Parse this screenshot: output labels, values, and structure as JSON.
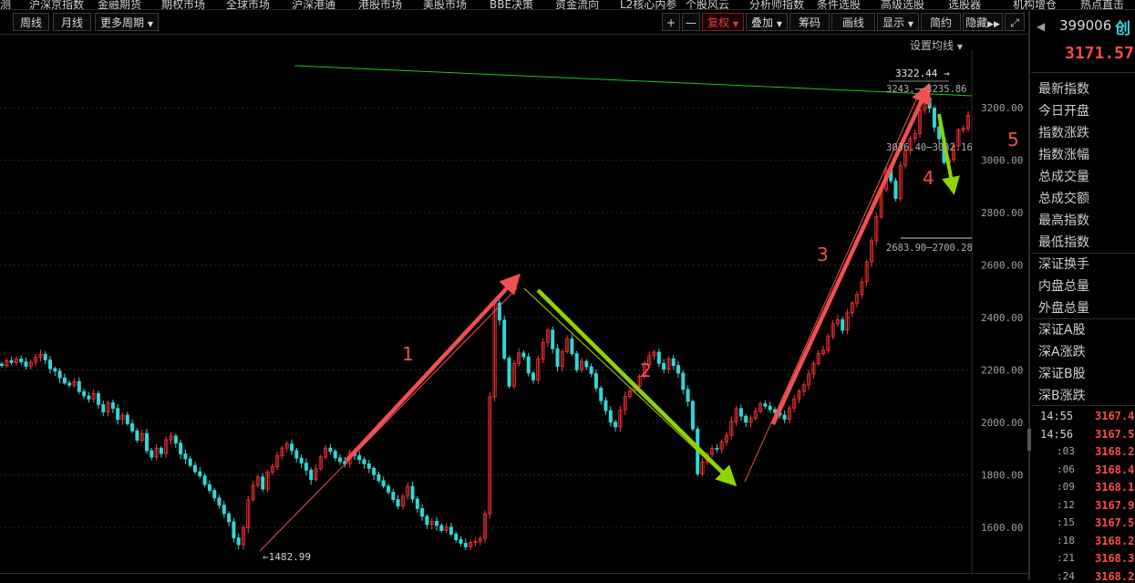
{
  "top_menu": [
    "测",
    "沪深京指数",
    "金融期货",
    "期权市场",
    "全球市场",
    "沪深港通",
    "港股市场",
    "美股市场",
    "BBE决策",
    "资金流向",
    "L2核心内参",
    "个股风云",
    "分析师指数",
    "条件选股",
    "高级选股",
    "选股器",
    "机构增仓",
    "热点直击"
  ],
  "toolbar": {
    "periods": [
      "周线",
      "月线",
      "更多周期"
    ],
    "plus": "+",
    "minus": "—",
    "restore_right": "复权",
    "overlay": "叠加",
    "chips": "筹码",
    "draw": "画线",
    "display": "显示",
    "simple": "简约",
    "hide": "隐藏"
  },
  "set_ma_label": "设置均线",
  "chart_data": {
    "type": "candlestick",
    "y_axis_ticks": [
      3200,
      3000,
      2800,
      2600,
      2400,
      2200,
      2000,
      1800,
      1600
    ],
    "y_tick_labels": [
      "3200.00",
      "3000.00",
      "2800.00",
      "2600.00",
      "2400.00",
      "2200.00",
      "2000.00",
      "1800.00",
      "1600.00"
    ],
    "ylim": [
      1500,
      3330
    ],
    "annotations": {
      "low_marker": "←1482.99",
      "high_marker": "3322.44 →",
      "box_top": "3243.──3235.86",
      "box_mid": "3036.40─3032.16",
      "box_low": "2683.90─2700.28"
    },
    "wave_labels": [
      "1",
      "2",
      "3",
      "4",
      "5"
    ],
    "closes": [
      2217,
      2235,
      2228,
      2242,
      2231,
      2214,
      2229,
      2248,
      2260,
      2238,
      2205,
      2196,
      2170,
      2150,
      2142,
      2156,
      2118,
      2101,
      2089,
      2110,
      2068,
      2040,
      2075,
      2053,
      2011,
      2028,
      1995,
      1968,
      1932,
      1958,
      1892,
      1868,
      1902,
      1881,
      1934,
      1948,
      1921,
      1880,
      1861,
      1836,
      1812,
      1796,
      1763,
      1741,
      1712,
      1685,
      1652,
      1621,
      1560,
      1534,
      1598,
      1705,
      1760,
      1792,
      1746,
      1811,
      1831,
      1873,
      1902,
      1918,
      1893,
      1864,
      1845,
      1818,
      1782,
      1824,
      1868,
      1902,
      1890,
      1865,
      1851,
      1842,
      1886,
      1874,
      1858,
      1842,
      1825,
      1801,
      1778,
      1757,
      1734,
      1706,
      1681,
      1719,
      1756,
      1708,
      1672,
      1642,
      1611,
      1623,
      1607,
      1588,
      1601,
      1574,
      1553,
      1539,
      1526,
      1542,
      1547,
      1558,
      1652,
      2098,
      2455,
      2390,
      2245,
      2138,
      2224,
      2265,
      2250,
      2188,
      2162,
      2242,
      2305,
      2352,
      2281,
      2214,
      2270,
      2318,
      2262,
      2201,
      2233,
      2212,
      2186,
      2131,
      2083,
      2045,
      2001,
      1983,
      2048,
      2099,
      2120,
      2138,
      2176,
      2221,
      2254,
      2268,
      2225,
      2203,
      2243,
      2217,
      2188,
      2126,
      2080,
      1975,
      1804,
      1849,
      1878,
      1901,
      1898,
      1925,
      1951,
      2004,
      2053,
      2024,
      2001,
      2015,
      2042,
      2071,
      2062,
      2049,
      2038,
      2028,
      2012,
      2055,
      2090,
      2119,
      2143,
      2185,
      2224,
      2262,
      2275,
      2328,
      2376,
      2392,
      2351,
      2418,
      2455,
      2488,
      2536,
      2612,
      2693,
      2784,
      2888,
      2963,
      2921,
      2854,
      2980,
      3036,
      3082,
      3101,
      3192,
      3236,
      3198,
      3126,
      3081,
      2991,
      3002,
      3054,
      3115,
      3121,
      3171
    ]
  },
  "right_panel": {
    "code": "399006",
    "name": "创",
    "price": "3171.57",
    "fields": [
      "最新指数",
      "今日开盘",
      "指数涨跌",
      "指数涨幅",
      "总成交量",
      "总成交额",
      "最高指数",
      "最低指数",
      "深证换手",
      "内盘总量",
      "外盘总量",
      "深证A股",
      "深A涨跌",
      "深证B股",
      "深B涨跌"
    ],
    "ticks": [
      {
        "time": "14:55",
        "price": "3167.4"
      },
      {
        "time": "14:56",
        "price": "3167.5"
      },
      {
        "time": ":03",
        "price": "3168.2"
      },
      {
        "time": ":06",
        "price": "3168.4"
      },
      {
        "time": ":09",
        "price": "3168.1"
      },
      {
        "time": ":12",
        "price": "3167.9"
      },
      {
        "time": ":15",
        "price": "3167.5"
      },
      {
        "time": ":18",
        "price": "3168.2"
      },
      {
        "time": ":21",
        "price": "3168.3"
      },
      {
        "time": ":24",
        "price": "3168.2"
      }
    ]
  },
  "colors": {
    "up": "#ff3333",
    "down": "#33d6d6",
    "arrow_red": "#f05050",
    "arrow_green": "#8fd400",
    "line_green": "#22c322",
    "grid": "#2a2a2a"
  }
}
